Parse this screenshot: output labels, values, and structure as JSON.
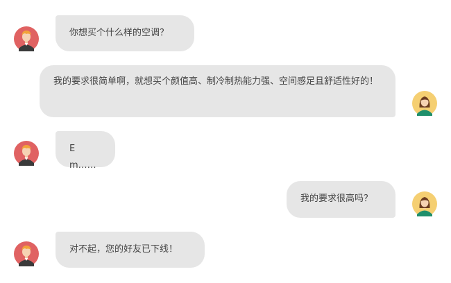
{
  "conversation": {
    "messages": [
      {
        "sender": "bot",
        "avatar_icon": "boy-avatar-icon",
        "text": "你想买个什么样的空调？"
      },
      {
        "sender": "user",
        "avatar_icon": "girl-avatar-icon",
        "text": "我的要求很简单啊，就想买个颜值高、制冷制热能力强、空间感足且舒适性好的！"
      },
      {
        "sender": "bot",
        "avatar_icon": "boy-avatar-icon",
        "text": "Em……"
      },
      {
        "sender": "user",
        "avatar_icon": "girl-avatar-icon",
        "text": "我的要求很高吗？"
      },
      {
        "sender": "bot",
        "avatar_icon": "boy-avatar-icon",
        "text": "对不起，您的好友已下线！"
      }
    ]
  },
  "colors": {
    "bubble_bg": "#e6e6e6",
    "bubble_text": "#444444",
    "boy_avatar_bg": "#e06262",
    "girl_avatar_bg": "#f5cf72"
  }
}
